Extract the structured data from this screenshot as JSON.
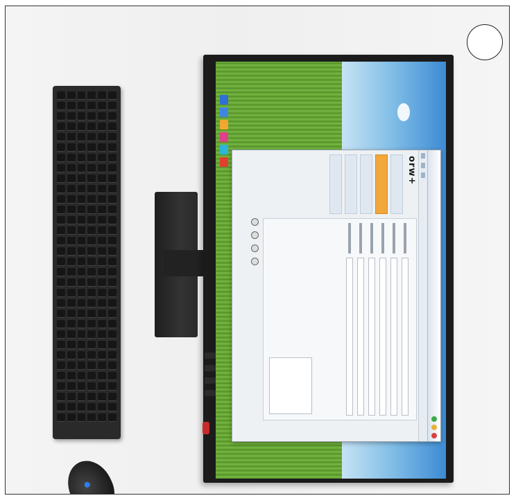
{
  "scene": {
    "objects": [
      "keyboard",
      "mouse",
      "monitor"
    ],
    "colors": {
      "monitor_bezel": "#1b1b1b",
      "sky": "#7fbce6",
      "grass": "#5c9b2c",
      "sidebar_active": "#f1a73b",
      "power_led": "#c72a2a"
    }
  },
  "app_window": {
    "brand": "orw+",
    "sidebar_items": [
      "",
      "",
      "",
      "",
      ""
    ],
    "window_controls": [
      "minimize-icon",
      "restore-icon",
      "close-icon"
    ]
  },
  "dock_icons": [
    "blue-app-icon",
    "blue-app-icon",
    "orange-app-icon",
    "pink-app-icon",
    "cyan-app-icon",
    "red-app-icon"
  ]
}
